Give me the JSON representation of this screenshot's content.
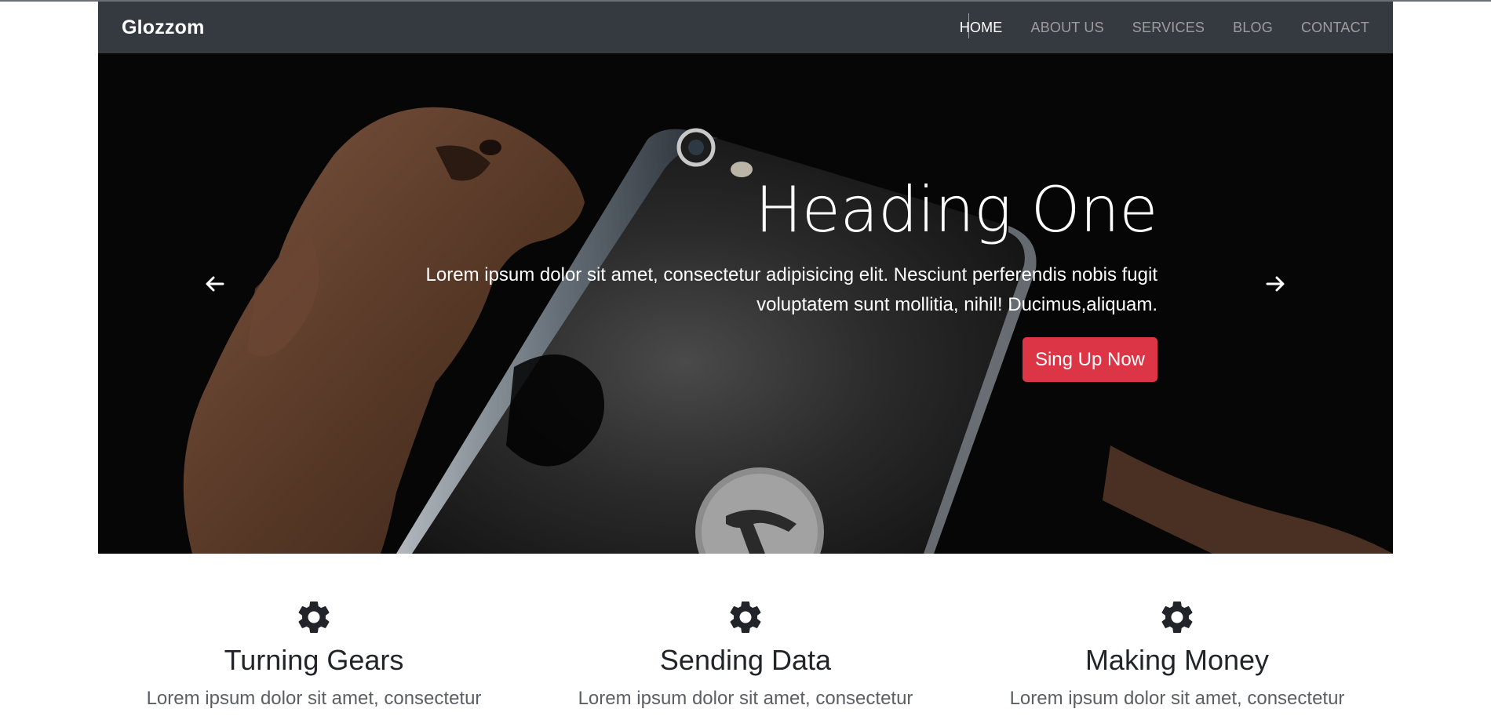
{
  "navbar": {
    "brand": "Glozzom",
    "items": [
      {
        "label": "HOME",
        "active": true
      },
      {
        "label": "ABOUT US",
        "active": false
      },
      {
        "label": "SERVICES",
        "active": false
      },
      {
        "label": "BLOG",
        "active": false
      },
      {
        "label": "CONTACT",
        "active": false
      }
    ]
  },
  "carousel": {
    "prev_icon": "arrow-left-icon",
    "next_icon": "arrow-right-icon",
    "heading": "Heading One",
    "text": "Lorem ipsum dolor sit amet, consectetur adipisicing elit. Nesciunt perferendis nobis fugit voluptatem sunt mollitia, nihil! Ducimus,aliquam.",
    "button_label": "Sing Up Now",
    "button_color": "#dc3545"
  },
  "features": [
    {
      "icon": "gear-icon",
      "title": "Turning Gears",
      "text": "Lorem ipsum dolor sit amet, consectetur"
    },
    {
      "icon": "gear-icon",
      "title": "Sending Data",
      "text": "Lorem ipsum dolor sit amet, consectetur"
    },
    {
      "icon": "gear-icon",
      "title": "Making Money",
      "text": "Lorem ipsum dolor sit amet, consectetur"
    }
  ],
  "colors": {
    "navbar_bg": "#343a40",
    "accent": "#dc3545",
    "text_dark": "#212529"
  }
}
